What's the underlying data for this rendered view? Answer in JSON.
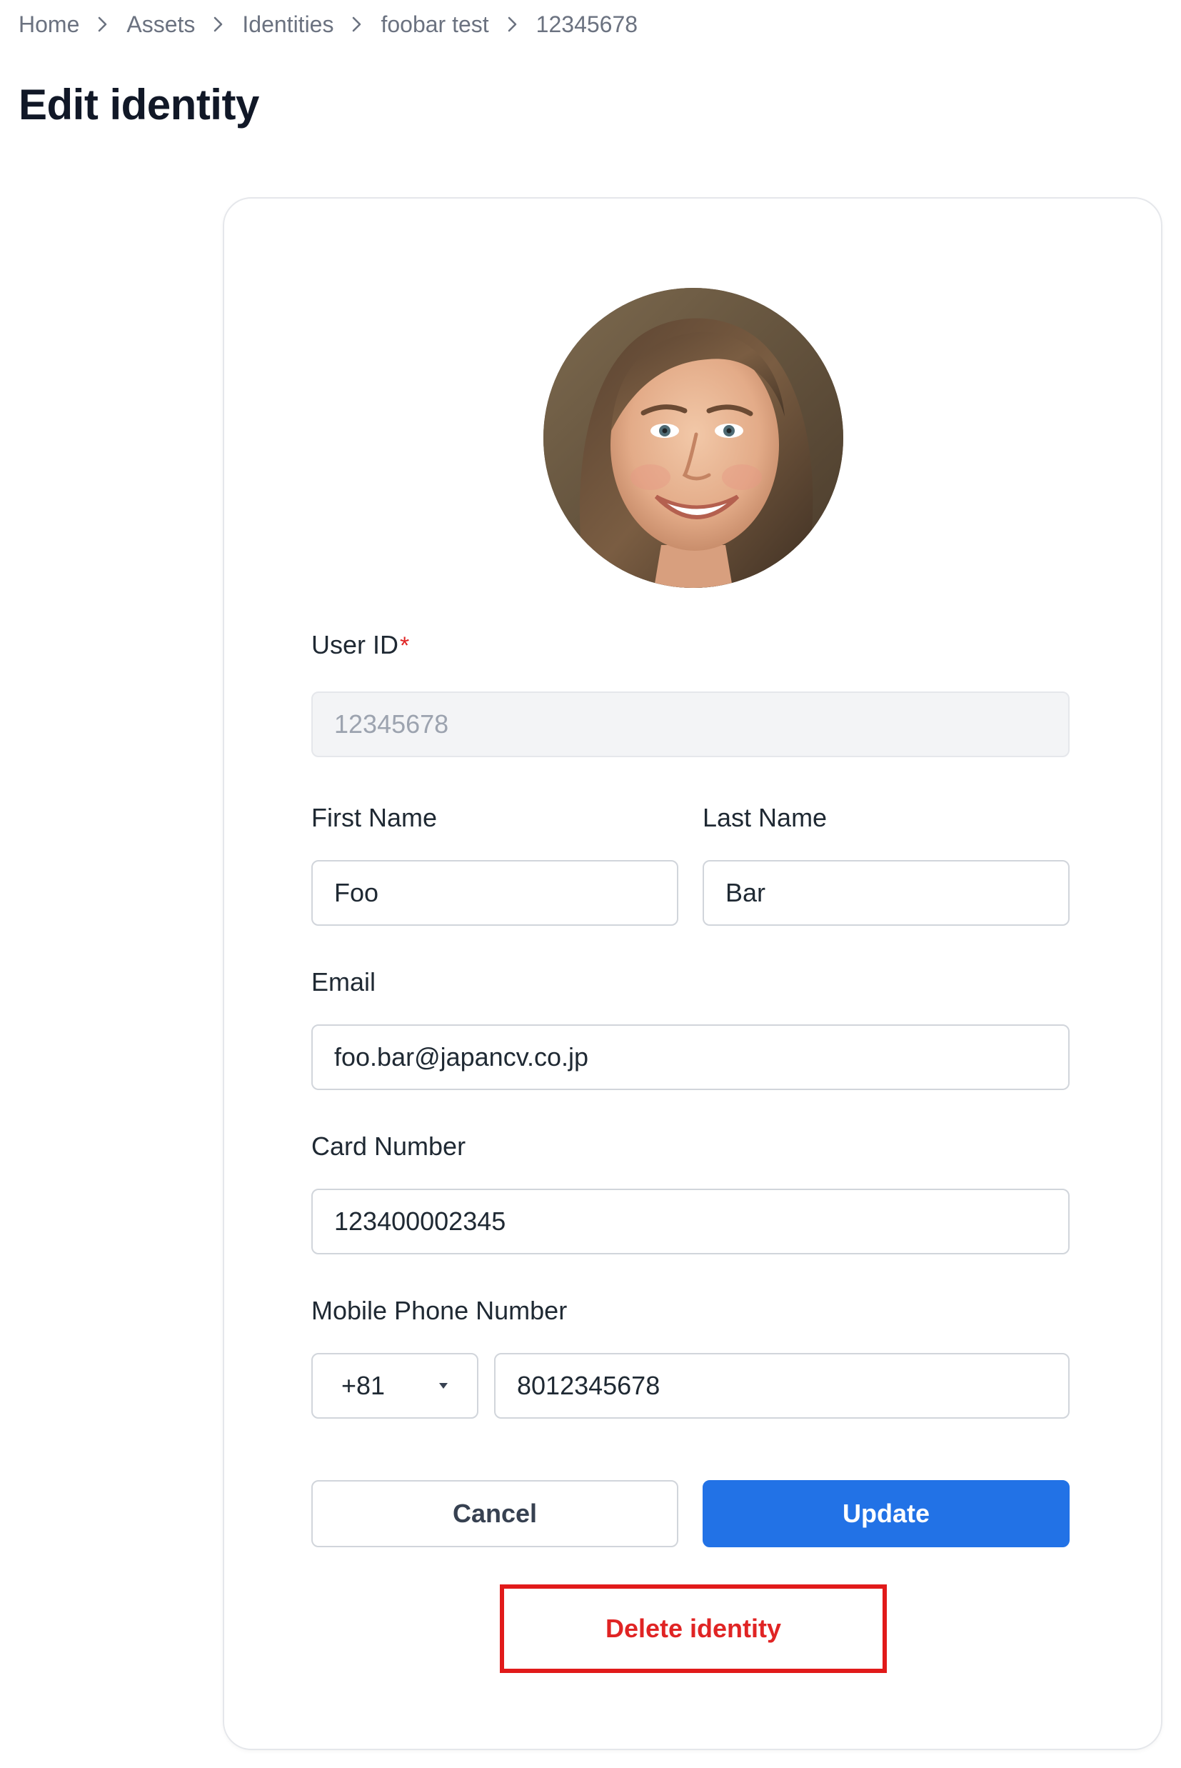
{
  "breadcrumb": {
    "items": [
      "Home",
      "Assets",
      "Identities",
      "foobar test",
      "12345678"
    ]
  },
  "page": {
    "title": "Edit identity"
  },
  "form": {
    "user_id": {
      "label": "User ID",
      "required_mark": "*",
      "value": "12345678"
    },
    "first_name": {
      "label": "First Name",
      "value": "Foo"
    },
    "last_name": {
      "label": "Last Name",
      "value": "Bar"
    },
    "email": {
      "label": "Email",
      "value": "foo.bar@japancv.co.jp"
    },
    "card_number": {
      "label": "Card Number",
      "value": "123400002345"
    },
    "mobile_phone": {
      "label": "Mobile Phone Number",
      "country_code": "+81",
      "number": "8012345678"
    }
  },
  "actions": {
    "cancel_label": "Cancel",
    "update_label": "Update",
    "delete_label": "Delete identity"
  },
  "icons": {
    "breadcrumb_separator": "chevron-right-icon",
    "select_caret": "caret-down-icon"
  },
  "colors": {
    "primary": "#2272e6",
    "danger": "#e02424",
    "required": "#e02424",
    "muted_text": "#6b7280"
  }
}
